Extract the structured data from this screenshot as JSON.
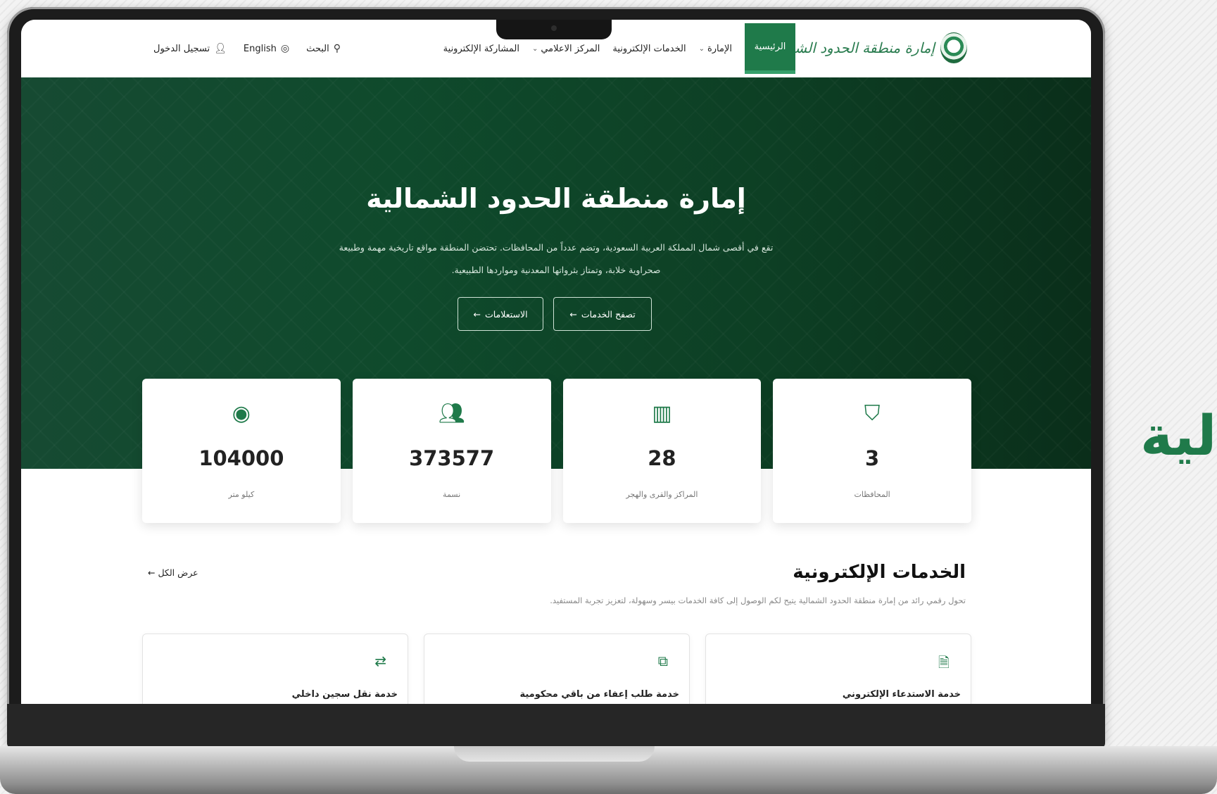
{
  "side_text": "لية",
  "logo": {
    "text": "إمارة منطقة الحدود الشمالية"
  },
  "nav": {
    "items": [
      {
        "label": "الرئيسية"
      },
      {
        "label": "الإمارة",
        "chevron": "⌄"
      },
      {
        "label": "الخدمات الإلكترونية"
      },
      {
        "label": "المركز الاعلامي",
        "chevron": "⌄"
      },
      {
        "label": "المشاركة الإلكترونية"
      }
    ]
  },
  "tools": {
    "search": "البحث",
    "language": "English",
    "login": "تسجيل الدخول"
  },
  "hero": {
    "title": "إمارة منطقة الحدود الشمالية",
    "line1": "تقع في أقصى شمال المملكة العربية السعودية، وتضم عدداً من المحافظات. تحتضن المنطقة مواقع تاريخية مهمة وطبيعة",
    "line2": "صحراوية خلابة، وتمتاز بثرواتها المعدنية ومواردها الطبيعية.",
    "btn_services": "تصفح الخدمات",
    "btn_inquiries": "الاستعلامات"
  },
  "stats": [
    {
      "value": "3",
      "label": "المحافظات",
      "icon": "map-icon"
    },
    {
      "value": "28",
      "label": "المراكز والقرى والهجر",
      "icon": "buildings-icon"
    },
    {
      "value": "373577",
      "label": "نسمة",
      "icon": "people-icon"
    },
    {
      "value": "104000",
      "label": "كيلو متر",
      "icon": "location-target-icon"
    }
  ],
  "services": {
    "title": "الخدمات الإلكترونية",
    "subtitle": "تحول رقمي رائد من إمارة منطقة الحدود الشمالية يتيح لكم الوصول إلى كافة الخدمات بيسر وسهولة، لتعزيز تجربة المستفيد.",
    "view_all": "عرض الكل",
    "cards": [
      {
        "title": "خدمة الاستدعاء الإلكتروني",
        "icon": "document-icon"
      },
      {
        "title": "خدمة طلب إعفاء من باقي محكومية",
        "icon": "external-link-icon"
      },
      {
        "title": "خدمة نقل سجين داخلي",
        "icon": "transfer-icon"
      }
    ]
  },
  "colors": {
    "brand_green": "#1f7a4a",
    "hero_dark": "#0d3f24"
  }
}
